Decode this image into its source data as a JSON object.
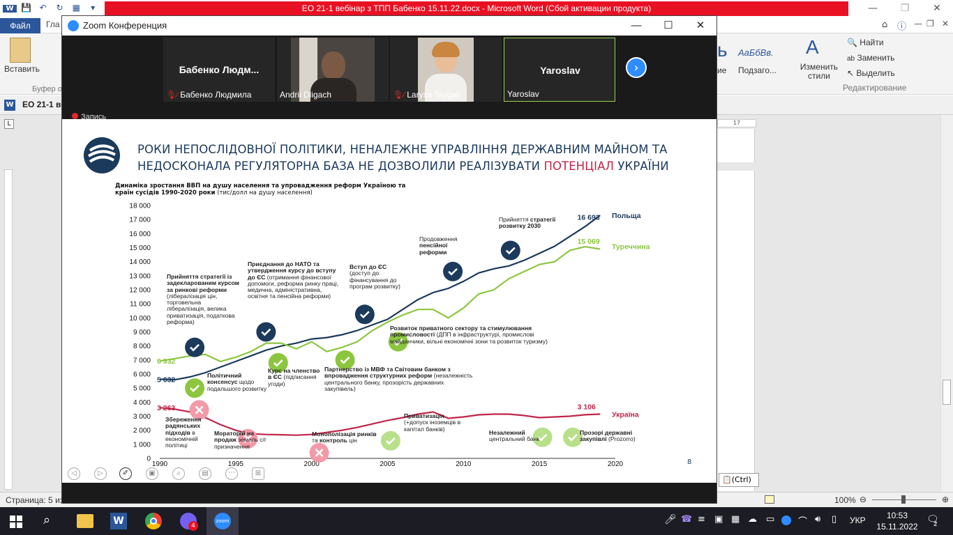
{
  "word": {
    "title": "ЕО 21-1 вебінар з ТПП Бабенко 15.11.22.docx  -  Microsoft Word (Сбой активации продукта)",
    "file_tab": "Файл",
    "tab_partial": "Гла",
    "paste_label": "Вставить",
    "clipboard_group": "Буфер о",
    "styles_sample_1": "ь",
    "style_label_1": "ие",
    "styles_sample_2": "АаБбВв.",
    "style_label_2": "Подзаго...",
    "change_styles": "Изменить стили",
    "find": "Найти",
    "replace": "Заменить",
    "select": "Выделить",
    "edit_group": "Редактирование",
    "doc_tab": "ЕО 21-1 ве",
    "ruler_mark": "17",
    "ctrl_badge": "(Ctrl)",
    "status_page": "Страница: 5 из",
    "zoom_pct": "100%"
  },
  "zoom": {
    "title": "Zoom Конференция",
    "recording": "Запись",
    "participants": [
      {
        "bigname": "Бабенко  Людм...",
        "label": "Бабенко Людмила",
        "muted": true,
        "video": false
      },
      {
        "bigname": "",
        "label": "Andrii Dligach",
        "muted": false,
        "video": true
      },
      {
        "bigname": "",
        "label": "Larysa Tsygan",
        "muted": true,
        "video": true
      },
      {
        "bigname": "Yaroslav",
        "label": "Yaroslav",
        "muted": false,
        "video": false
      }
    ]
  },
  "slide": {
    "title_part1": "РОКИ НЕПОСЛІДОВНОЇ ПОЛІТИКИ, НЕНАЛЕЖНЕ УПРАВЛІННЯ ДЕРЖАВНИМ МАЙНОМ ТА НЕДОСКОНАЛА РЕГУЛЯТОРНА БАЗА НЕ ДОЗВОЛИЛИ РЕАЛІЗУВАТИ ",
    "title_red": "ПОТЕНЦІАЛ",
    "title_part3": " УКРАЇНИ",
    "caption_bold": "Динаміка зростання ВВП на душу населення та упровадження реформ Україною та країн сусідів 1990-2020 роки",
    "caption_unit": " (тис/долл на душу населення)",
    "page_number": "8"
  },
  "chart_data": {
    "type": "line",
    "x": [
      1990,
      1991,
      1992,
      1993,
      1994,
      1995,
      1996,
      1997,
      1998,
      1999,
      2000,
      2001,
      2002,
      2003,
      2004,
      2005,
      2006,
      2007,
      2008,
      2009,
      2010,
      2011,
      2012,
      2013,
      2014,
      2015,
      2016,
      2017,
      2018,
      2019
    ],
    "xlim": [
      1990,
      2020
    ],
    "ylim": [
      0,
      18000
    ],
    "x_ticks": [
      1990,
      1995,
      2000,
      2005,
      2010,
      2015,
      2020
    ],
    "y_ticks": [
      0,
      1000,
      2000,
      3000,
      4000,
      5000,
      6000,
      7000,
      8000,
      9000,
      10000,
      11000,
      12000,
      13000,
      14000,
      15000,
      16000,
      17000,
      18000
    ],
    "y_tick_labels": [
      "0",
      "1 000",
      "2 000",
      "3 000",
      "4 000",
      "5 000",
      "6 000",
      "7 000",
      "8 000",
      "9 000",
      "10 000",
      "11 000",
      "12 000",
      "13 000",
      "14 000",
      "15 000",
      "16 000",
      "17 000",
      "18 000"
    ],
    "series": [
      {
        "name": "Польща",
        "color": "#1b3a5c",
        "start_label": "5 632",
        "end_label": "16 693",
        "values": [
          5632,
          5600,
          5800,
          6100,
          6500,
          6900,
          7300,
          7700,
          8000,
          8200,
          8500,
          8600,
          8800,
          9100,
          9500,
          9900,
          10600,
          11300,
          11800,
          12100,
          12600,
          13200,
          13500,
          13700,
          14100,
          14600,
          15100,
          15800,
          16500,
          17300
        ]
      },
      {
        "name": "Туреччина",
        "color": "#8cc63f",
        "start_label": "6 932",
        "end_label": "15 069",
        "values": [
          6932,
          7100,
          7300,
          7400,
          6900,
          7200,
          7600,
          8200,
          8200,
          7800,
          8300,
          7600,
          7900,
          8300,
          9100,
          9700,
          10200,
          10600,
          10600,
          10000,
          10700,
          11700,
          12000,
          12800,
          13300,
          13800,
          14000,
          14800,
          15069,
          14900
        ]
      },
      {
        "name": "Україна",
        "color": "#c0254a",
        "start_label": "3 263",
        "end_label": "3 106",
        "values": [
          3610,
          3500,
          3300,
          2900,
          2400,
          2000,
          1750,
          1700,
          1680,
          1650,
          1700,
          1850,
          2000,
          2200,
          2450,
          2700,
          2900,
          3150,
          3300,
          2850,
          2950,
          3100,
          3150,
          3150,
          3050,
          2900,
          2950,
          3000,
          3106,
          3150
        ]
      }
    ],
    "annotations": [
      {
        "text_bold": "Прийняття стратегії із задекларованим курсом за ринкові реформи",
        "text": " (лібералізація цін, торговельна лібералізація, велика приватизація, податкова реформа)",
        "kind": "check-dark"
      },
      {
        "text_bold": "Приєднання до НАТО та утвердження курсу до вступу до ЄС",
        "text": " (отримання фінансової допомоги, реформа ринку праці, медична, адміністративна, освітня та пенсійна реформи)",
        "kind": "check-dark"
      },
      {
        "text_bold": "Вступ до ЄС",
        "text": " (доступ до фінансування до програм розвитку)",
        "kind": "check-dark"
      },
      {
        "text": "Продовження ",
        "text_bold": "пенсійної реформи",
        "kind": "check-dark"
      },
      {
        "text": "Прийняття ",
        "text_bold": "стратегії розвитку 2030",
        "kind": "check-dark"
      },
      {
        "text_bold": "Політичний консенсус",
        "text": " щодо подальшого розвитку",
        "kind": "check-green"
      },
      {
        "text_bold": "Курс на членство в ЄС",
        "text": " (підписання угоди)",
        "kind": "check-green"
      },
      {
        "text_bold": "Партнерство із МВФ та Світовим банком з впровадження структурних реформ",
        "text": " (незалежність центрального банку, прозорість державних закупівель)",
        "kind": "check-green"
      },
      {
        "text_bold": "Розвиток приватного сектору та стимулювання промисловості",
        "text": " (ДПП в інфраструктурі, промислові майданчики, вільні економічні зони та розвиток туризму)",
        "kind": "check-green"
      },
      {
        "text_bold": "Збереження радянських підходів",
        "text": " в економічній політиці",
        "kind": "cross"
      },
      {
        "text_bold": "Мораторій на продаж",
        "text": " земель с/г призначення",
        "kind": "cross"
      },
      {
        "text_bold": "Монополізація ринків",
        "text": " та ",
        "text_bold2": "контроль",
        "text2": " цін",
        "kind": "cross"
      },
      {
        "text_bold": "Приватизація",
        "text": " (+допуск іноземців в капітал банків)",
        "kind": "check-light"
      },
      {
        "text_bold": "Незалежний",
        "text": " центральний банк",
        "kind": "check-light"
      },
      {
        "text_bold": "Прозорі державні закупівлі",
        "text": " (Prozorro)",
        "kind": "check-light"
      }
    ]
  },
  "taskbar": {
    "lang": "УКР",
    "time": "10:53",
    "date": "15.11.2022",
    "notifications": "2",
    "viber_badge": "4"
  }
}
